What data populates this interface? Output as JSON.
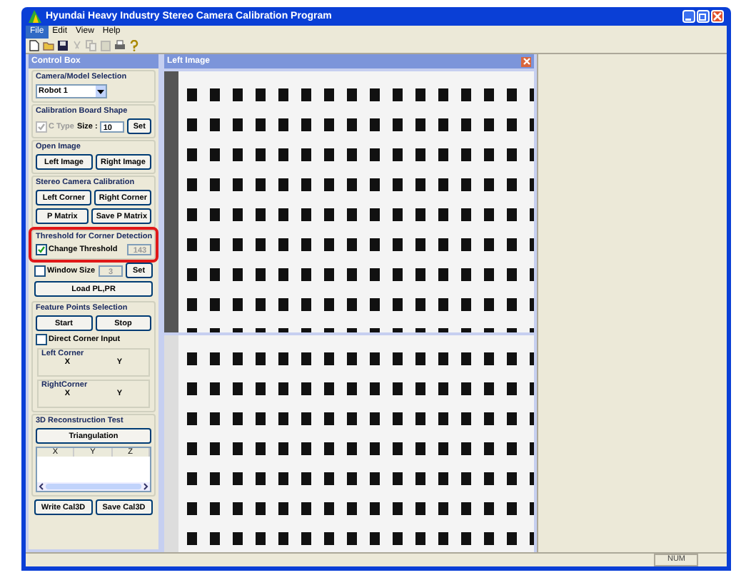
{
  "window": {
    "title": "Hyundai Heavy Industry Stereo Camera Calibration Program"
  },
  "menu": [
    {
      "label": "File",
      "selected": true
    },
    {
      "label": "Edit",
      "selected": false
    },
    {
      "label": "View",
      "selected": false
    },
    {
      "label": "Help",
      "selected": false
    }
  ],
  "control_box": {
    "title": "Control Box",
    "groups": [
      {
        "title": "Camera/Model Selection",
        "highlighted": false,
        "items": [
          {
            "kind": "select",
            "value": "Robot 1"
          }
        ]
      },
      {
        "title": "Calibration Board Shape",
        "highlighted": false,
        "items": [
          {
            "kind": "row",
            "items": [
              {
                "kind": "checkbox",
                "label": "C Type",
                "checked": true,
                "disabled": true
              },
              {
                "kind": "label",
                "text": "Size :"
              },
              {
                "kind": "input",
                "value": "10",
                "disabled": false
              },
              {
                "kind": "button",
                "label": "Set"
              }
            ]
          }
        ]
      },
      {
        "title": "Open Image",
        "highlighted": false,
        "items": [
          {
            "kind": "row",
            "items": [
              {
                "kind": "button",
                "label": "Left Image"
              },
              {
                "kind": "button",
                "label": "Right Image"
              }
            ]
          }
        ]
      },
      {
        "title": "Stereo Camera Calibration",
        "highlighted": false,
        "items": [
          {
            "kind": "row",
            "items": [
              {
                "kind": "button",
                "label": "Left Corner"
              },
              {
                "kind": "button",
                "label": "Right Corner"
              }
            ]
          },
          {
            "kind": "row",
            "items": [
              {
                "kind": "button",
                "label": "P Matrix"
              },
              {
                "kind": "button",
                "label": "Save P Matrix"
              }
            ]
          }
        ]
      },
      {
        "title": "Threshold for Corner Detection",
        "highlighted": true,
        "items": [
          {
            "kind": "row",
            "items": [
              {
                "kind": "checkbox",
                "label": "Change Threshold",
                "checked": true,
                "disabled": false
              },
              {
                "kind": "input",
                "value": "143",
                "disabled": true
              }
            ]
          }
        ]
      },
      {
        "highlighted": false,
        "items": [
          {
            "kind": "row",
            "items": [
              {
                "kind": "checkbox",
                "label": "Window Size",
                "checked": false,
                "disabled": false
              },
              {
                "kind": "input",
                "value": "3",
                "disabled": true
              },
              {
                "kind": "button",
                "label": "Set"
              }
            ]
          },
          {
            "kind": "row",
            "items": [
              {
                "kind": "button",
                "label": "Load PL,PR"
              }
            ]
          }
        ]
      },
      {
        "title": "Feature Points Selection",
        "highlighted": false,
        "items": [
          {
            "kind": "row",
            "items": [
              {
                "kind": "button",
                "label": "Start"
              },
              {
                "kind": "button",
                "label": "Stop"
              }
            ]
          },
          {
            "kind": "row",
            "items": [
              {
                "kind": "checkbox",
                "label": "Direct Corner Input",
                "checked": false,
                "disabled": false
              }
            ]
          },
          {
            "kind": "subgroup",
            "title": "Left Corner",
            "labels": [
              "X",
              "Y"
            ]
          },
          {
            "kind": "subgroup",
            "title": "RightCorner",
            "labels": [
              "X",
              "Y"
            ]
          }
        ]
      },
      {
        "title": "3D Reconstruction Test",
        "highlighted": false,
        "items": [
          {
            "kind": "row",
            "items": [
              {
                "kind": "button",
                "label": "Triangulation"
              }
            ]
          },
          {
            "kind": "listview",
            "columns": [
              "X",
              "Y",
              "Z"
            ]
          }
        ]
      },
      {
        "highlighted": false,
        "items": [
          {
            "kind": "row",
            "items": [
              {
                "kind": "button",
                "label": "Write Cal3D"
              },
              {
                "kind": "button",
                "label": "Save Cal3D"
              }
            ]
          }
        ]
      }
    ]
  },
  "image_window": {
    "title": "Left Image"
  },
  "status_bar": {
    "indicator": "NUM"
  }
}
